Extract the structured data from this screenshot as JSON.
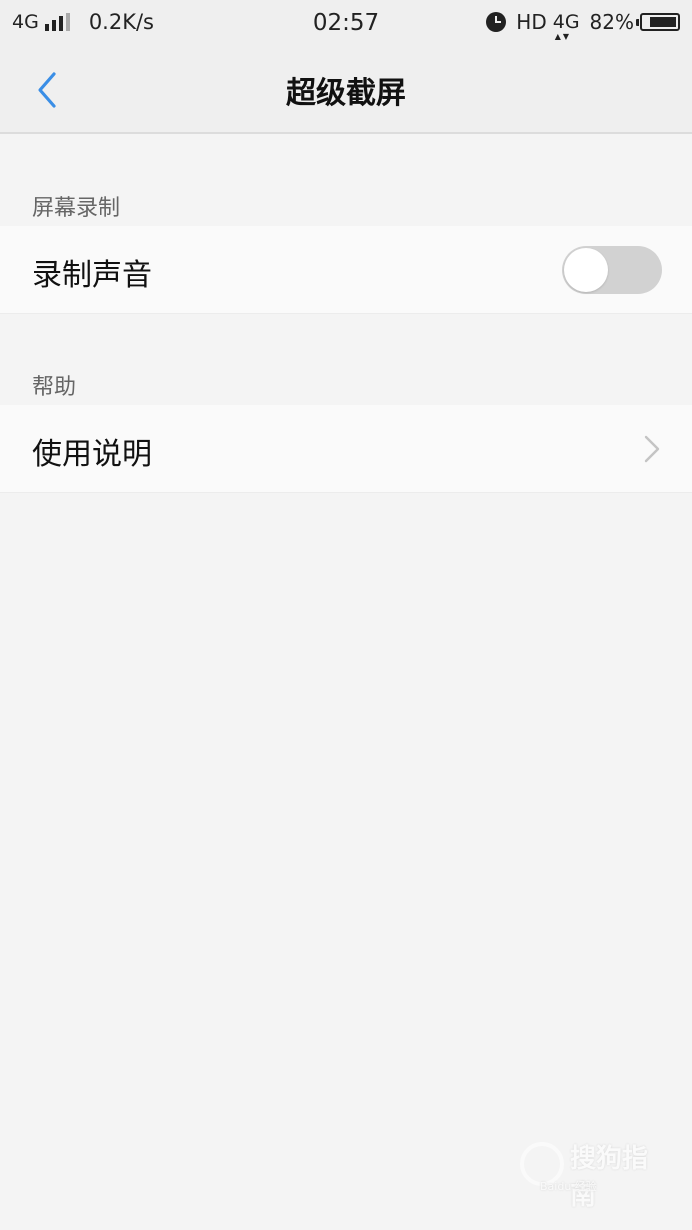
{
  "status_bar": {
    "network_left": "4G",
    "speed": "0.2K/s",
    "time": "02:57",
    "hd": "HD",
    "network_right": "4G",
    "battery_percent": "82%",
    "battery_level": 0.82,
    "icons": [
      "signal-icon",
      "alarm-icon",
      "battery-icon"
    ]
  },
  "nav": {
    "title": "超级截屏",
    "back_icon": "chevron-left-icon",
    "accent_color": "#3a8ee6"
  },
  "sections": [
    {
      "header": "屏幕录制",
      "row_label": "录制声音",
      "toggle_on": false
    },
    {
      "header": "帮助",
      "row_label": "使用说明",
      "row_icon": "chevron-right-icon"
    }
  ]
}
